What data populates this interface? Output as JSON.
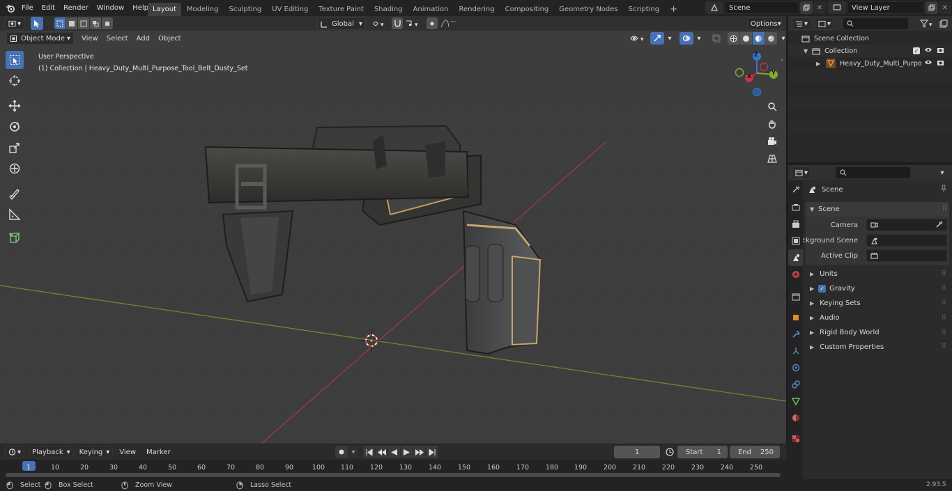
{
  "topbar": {
    "menus": [
      "File",
      "Edit",
      "Render",
      "Window",
      "Help"
    ],
    "workspaces": [
      "Layout",
      "Modeling",
      "Sculpting",
      "UV Editing",
      "Texture Paint",
      "Shading",
      "Animation",
      "Rendering",
      "Compositing",
      "Geometry Nodes",
      "Scripting"
    ],
    "active_workspace": "Layout",
    "add_tab": "+",
    "scene_name": "Scene",
    "view_layer": "View Layer"
  },
  "viewport_header": {
    "mode": "Object Mode",
    "menus": [
      "View",
      "Select",
      "Add",
      "Object"
    ],
    "transform_orientation": "Global",
    "options_label": "Options"
  },
  "viewport": {
    "perspective_label": "User Perspective",
    "object_info": "(1) Collection | Heavy_Duty_Multi_Purpose_Tool_Belt_Dusty_Set",
    "gizmo": {
      "x": "X",
      "y": "Y",
      "z": "Z"
    }
  },
  "outliner": {
    "root": "Scene Collection",
    "collection": "Collection",
    "object": "Heavy_Duty_Multi_Purpo"
  },
  "properties": {
    "context": "Scene",
    "panel_title": "Scene",
    "fields": [
      {
        "label": "Camera"
      },
      {
        "label": "Background Scene"
      },
      {
        "label": "Active Clip"
      }
    ],
    "sections": [
      "Units",
      "Gravity",
      "Keying Sets",
      "Audio",
      "Rigid Body World",
      "Custom Properties"
    ],
    "gravity_enabled": true
  },
  "timeline": {
    "menus": [
      "Playback",
      "Keying",
      "View",
      "Marker"
    ],
    "current_frame": "1",
    "start_label": "Start",
    "start": "1",
    "end_label": "End",
    "end": "250",
    "ruler": [
      "1",
      "10",
      "20",
      "30",
      "40",
      "50",
      "60",
      "70",
      "80",
      "90",
      "100",
      "110",
      "120",
      "130",
      "140",
      "150",
      "160",
      "170",
      "180",
      "190",
      "200",
      "210",
      "220",
      "230",
      "240",
      "250"
    ]
  },
  "status_bar": {
    "select": "Select",
    "box_select": "Box Select",
    "zoom_view": "Zoom View",
    "lasso_select": "Lasso Select",
    "version": "2.93.5"
  },
  "colors": {
    "accent": "#4772b3",
    "x_axis": "#c4344a",
    "y_axis": "#82ad2c",
    "z_axis": "#3a76cc"
  }
}
